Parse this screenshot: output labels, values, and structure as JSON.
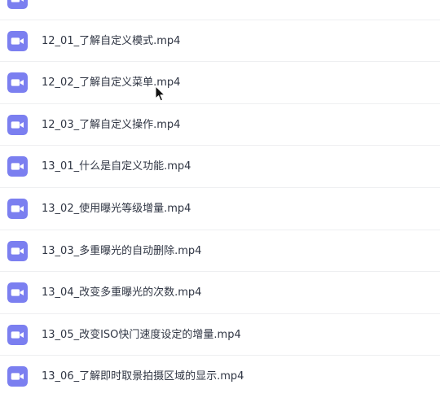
{
  "file_list": {
    "item_icon": "video-file-icon",
    "icon_color": "#7b7ff0",
    "items": [
      {
        "name": ""
      },
      {
        "name": "12_01_了解自定义模式.mp4"
      },
      {
        "name": "12_02_了解自定义菜单.mp4"
      },
      {
        "name": "12_03_了解自定义操作.mp4"
      },
      {
        "name": "13_01_什么是自定义功能.mp4"
      },
      {
        "name": "13_02_使用曝光等级增量.mp4"
      },
      {
        "name": "13_03_多重曝光的自动删除.mp4"
      },
      {
        "name": "13_04_改变多重曝光的次数.mp4"
      },
      {
        "name": "13_05_改变ISO快门速度设定的增量.mp4"
      },
      {
        "name": "13_06_了解即时取景拍摄区域的显示.mp4"
      }
    ]
  },
  "cursor": {
    "icon": "mouse-pointer-icon"
  }
}
